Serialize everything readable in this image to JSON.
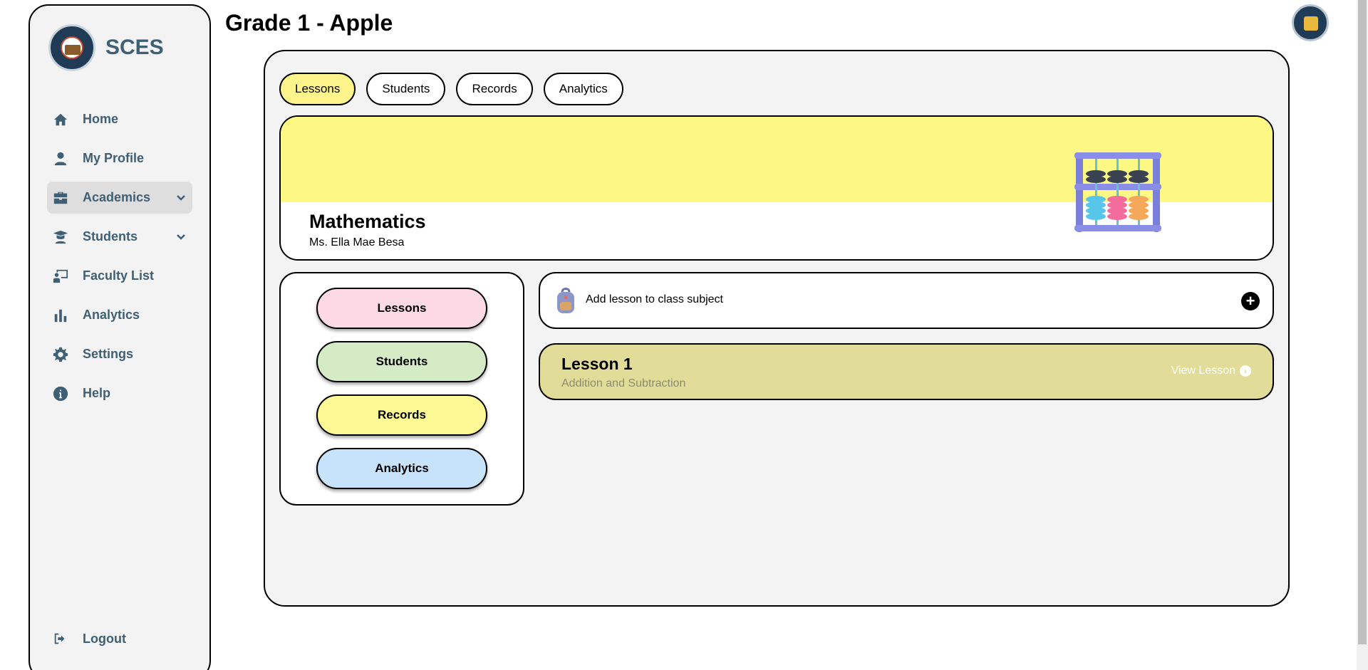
{
  "brand": {
    "name": "SCES"
  },
  "sidebar": {
    "items": [
      {
        "label": "Home",
        "icon": "home-icon"
      },
      {
        "label": "My Profile",
        "icon": "user-icon"
      },
      {
        "label": "Academics",
        "icon": "briefcase-icon",
        "active": true,
        "expandable": true
      },
      {
        "label": "Students",
        "icon": "graduate-icon",
        "expandable": true
      },
      {
        "label": "Faculty List",
        "icon": "teacher-board-icon"
      },
      {
        "label": "Analytics",
        "icon": "bar-chart-icon"
      },
      {
        "label": "Settings",
        "icon": "gear-icon"
      },
      {
        "label": "Help",
        "icon": "info-icon"
      }
    ],
    "logout": "Logout"
  },
  "page": {
    "title": "Grade 1 - Apple"
  },
  "tabs": [
    {
      "label": "Lessons",
      "active": true
    },
    {
      "label": "Students"
    },
    {
      "label": "Records"
    },
    {
      "label": "Analytics"
    }
  ],
  "banner": {
    "subject": "Mathematics",
    "teacher": "Ms. Ella Mae Besa"
  },
  "side_panel": {
    "buttons": [
      {
        "label": "Lessons",
        "color": "#fdd9e5"
      },
      {
        "label": "Students",
        "color": "#d5ebc6"
      },
      {
        "label": "Records",
        "color": "#fdfa95"
      },
      {
        "label": "Analytics",
        "color": "#c7e2fb"
      }
    ]
  },
  "add_lesson": {
    "label": "Add lesson to class subject"
  },
  "lessons": [
    {
      "title": "Lesson 1",
      "subtitle": "Addition and Subtraction",
      "action": "View Lesson"
    }
  ],
  "colors": {
    "accent_text": "#3f5f75",
    "tab_active": "#fdf48c",
    "banner": "#fdf784",
    "lesson_card": "#e1dc97"
  }
}
